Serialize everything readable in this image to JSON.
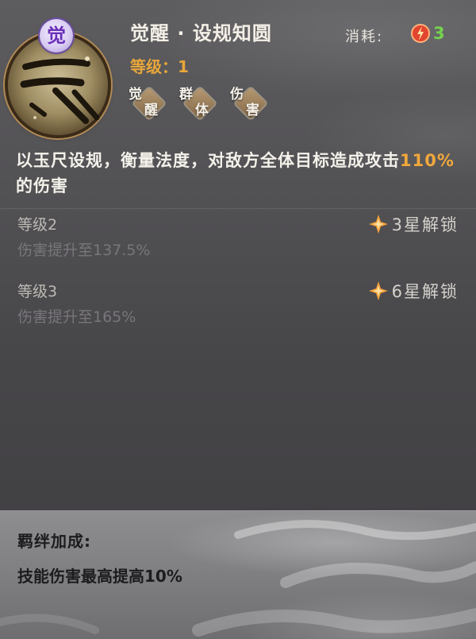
{
  "skill": {
    "awaken_badge": "觉",
    "title": "觉醒 · 设规知圆",
    "level_label": "等级：1",
    "cost_label": "消耗:",
    "cost_value": "3",
    "cost_icon": "orb-icon",
    "tags": [
      {
        "char1": "觉",
        "char2": "醒"
      },
      {
        "char1": "群",
        "char2": "体"
      },
      {
        "char1": "伤",
        "char2": "害"
      }
    ],
    "description_prefix": "以玉尺设规，衡量法度，对敌方全体目标造成攻击",
    "description_highlight": "110%",
    "description_suffix": "的伤害"
  },
  "levels": [
    {
      "name": "等级2",
      "effect": "伤害提升至137.5%",
      "unlock": "3星解锁",
      "unlock_icon": "star-icon"
    },
    {
      "name": "等级3",
      "effect": "伤害提升至165%",
      "unlock": "6星解锁",
      "unlock_icon": "star-icon"
    }
  ],
  "bond": {
    "title": "羁绊加成:",
    "effect": "技能伤害最高提高10%"
  },
  "colors": {
    "highlight": "#f0a83c",
    "cost_value": "#74d34e",
    "awaken_badge": "#6a2fb8"
  }
}
